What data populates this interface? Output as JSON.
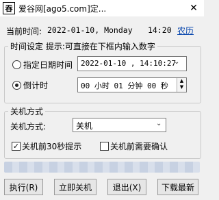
{
  "window": {
    "title": "爱谷网[ago5.com]定...",
    "icon_glyph": "吞",
    "close_glyph": "✕"
  },
  "header": {
    "label": "当前时间:",
    "date": "2022-01-10, Monday",
    "time": "14:20",
    "lunar_link": "农历"
  },
  "time_setting": {
    "group_label": "时间设定 提示:可直接在下框内输入数字",
    "specified_option": "指定日期时间",
    "datetime_value": "2022-01-10 , 14:10:27",
    "countdown_option": "倒计时",
    "countdown_value": "00 小时 01 分钟 00 秒",
    "selected": "countdown"
  },
  "shutdown": {
    "group_label": "关机方式",
    "method_label": "关机方式:",
    "method_value": "关机",
    "prompt_30s_label": "关机前30秒提示",
    "prompt_30s_checked": true,
    "confirm_label": "关机前需要确认",
    "confirm_checked": false
  },
  "progress": {
    "fraction": 1.0,
    "color": "#cdd6e6"
  },
  "buttons": {
    "execute": "执行(R)",
    "shutdown_now": "立即关机",
    "exit": "退出(X)",
    "download": "下载最新"
  }
}
